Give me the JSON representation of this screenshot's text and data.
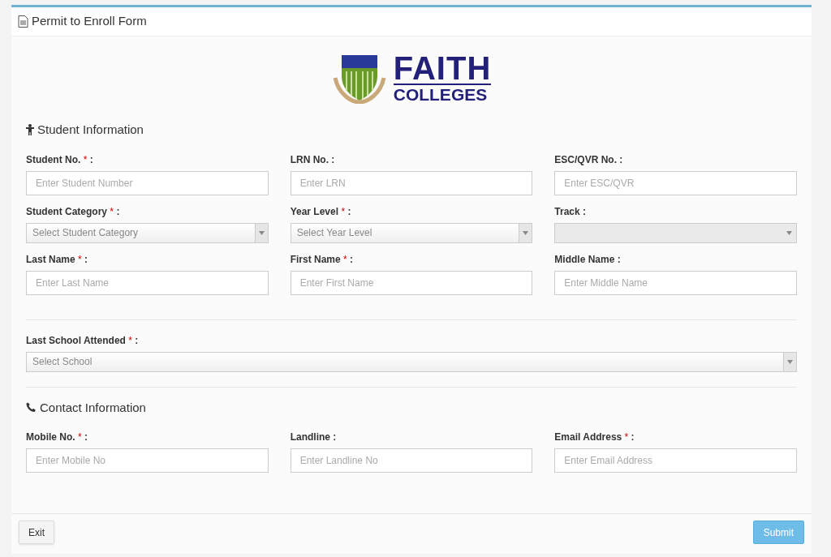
{
  "panel": {
    "title": "Permit to Enroll Form"
  },
  "logo": {
    "line_1": "FAITH",
    "line_2": "COLLEGES"
  },
  "sections": [
    {
      "kind": "student",
      "title": "Student Information",
      "rows": [
        [
          {
            "kind": "input",
            "label": "Student No.",
            "mark": "*",
            "suffix": ":",
            "placeholder": "Enter Student Number"
          },
          {
            "kind": "input",
            "label": "LRN No.",
            "suffix": ":",
            "placeholder": "Enter LRN"
          },
          {
            "kind": "input",
            "label": "ESC/QVR No.",
            "suffix": ":",
            "placeholder": "Enter ESC/QVR"
          }
        ],
        [
          {
            "kind": "select",
            "label": "Student Category",
            "mark": "*",
            "suffix": ":",
            "placeholder": "Select Student Category",
            "disabled": false
          },
          {
            "kind": "select",
            "label": "Year Level",
            "mark": "*",
            "suffix": ":",
            "placeholder": "Select Year Level",
            "disabled": false
          },
          {
            "kind": "select",
            "label": "Track",
            "suffix": ":",
            "disabled": true
          }
        ],
        [
          {
            "kind": "input",
            "label": "Last Name",
            "mark": "*",
            "suffix": ":",
            "placeholder": "Enter Last Name"
          },
          {
            "kind": "input",
            "label": "First Name",
            "mark": "*",
            "suffix": ":",
            "placeholder": "Enter First Name"
          },
          {
            "kind": "input",
            "label": "Middle Name",
            "suffix": ":",
            "placeholder": "Enter Middle Name"
          }
        ]
      ],
      "wide": {
        "kind": "select",
        "label": "Last School Attended",
        "mark": "*",
        "suffix": ":",
        "placeholder": "Select School",
        "disabled": false
      }
    },
    {
      "kind": "contact",
      "title": "Contact Information",
      "rows": [
        [
          {
            "kind": "input",
            "label": "Mobile No.",
            "mark": "*",
            "suffix": ":",
            "placeholder": "Enter Mobile No"
          },
          {
            "kind": "input",
            "label": "Landline",
            "suffix": ":",
            "placeholder": "Enter Landline No"
          },
          {
            "kind": "input",
            "label": "Email Address",
            "mark": "*",
            "suffix": ":",
            "placeholder": "Enter Email Address"
          }
        ]
      ]
    }
  ],
  "footer": {
    "exit": "Exit",
    "submit": "Submit"
  }
}
